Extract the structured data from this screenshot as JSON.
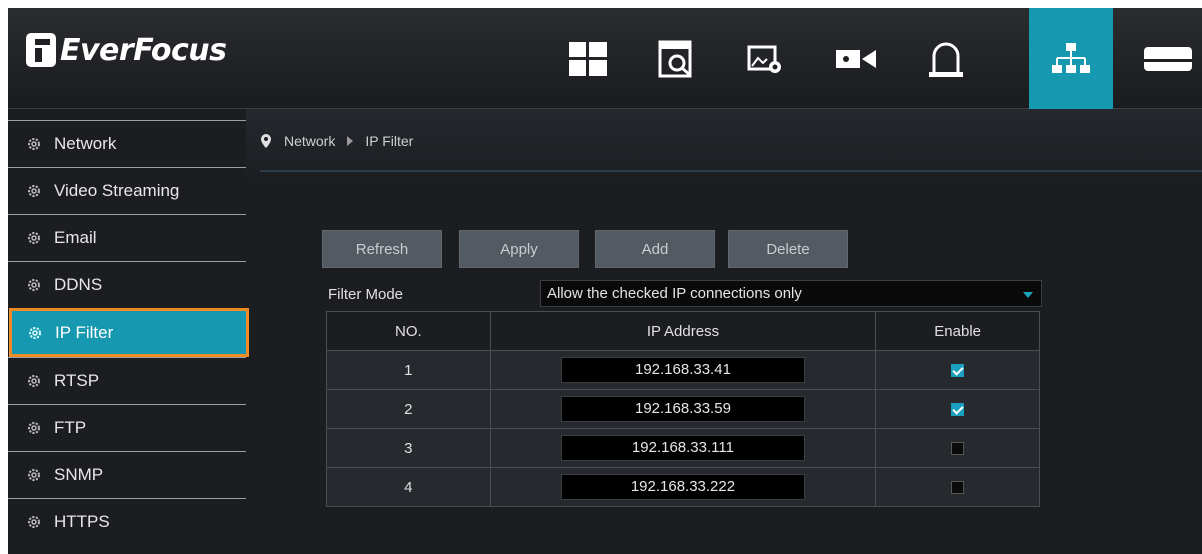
{
  "brand": {
    "name": "EverFocus"
  },
  "colors": {
    "accent": "#1598b0",
    "highlight_border": "#f08a24",
    "background": "#1b1d21"
  },
  "topnav": {
    "icons": [
      {
        "name": "live-view-grid-icon",
        "active": false
      },
      {
        "name": "playback-search-icon",
        "active": false
      },
      {
        "name": "image-settings-icon",
        "active": false
      },
      {
        "name": "camera-record-icon",
        "active": false
      },
      {
        "name": "alarm-bell-icon",
        "active": false
      },
      {
        "name": "network-icon",
        "active": true
      },
      {
        "name": "storage-hdd-icon",
        "active": false
      }
    ]
  },
  "sidebar": {
    "items": [
      {
        "label": "Network",
        "active": false
      },
      {
        "label": "Video Streaming",
        "active": false
      },
      {
        "label": "Email",
        "active": false
      },
      {
        "label": "DDNS",
        "active": false
      },
      {
        "label": "IP Filter",
        "active": true
      },
      {
        "label": "RTSP",
        "active": false
      },
      {
        "label": "FTP",
        "active": false
      },
      {
        "label": "SNMP",
        "active": false
      },
      {
        "label": "HTTPS",
        "active": false
      }
    ]
  },
  "breadcrumb": {
    "section": "Network",
    "page": "IP Filter"
  },
  "toolbar": {
    "refresh": "Refresh",
    "apply": "Apply",
    "add": "Add",
    "delete": "Delete"
  },
  "filter_mode": {
    "label": "Filter Mode",
    "value": "Allow the checked IP connections only"
  },
  "table": {
    "headers": {
      "no": "NO.",
      "ip": "IP Address",
      "enable": "Enable"
    },
    "rows": [
      {
        "no": "1",
        "ip": "192.168.33.41",
        "enabled": true
      },
      {
        "no": "2",
        "ip": "192.168.33.59",
        "enabled": true
      },
      {
        "no": "3",
        "ip": "192.168.33.111",
        "enabled": false
      },
      {
        "no": "4",
        "ip": "192.168.33.222",
        "enabled": false
      }
    ]
  }
}
